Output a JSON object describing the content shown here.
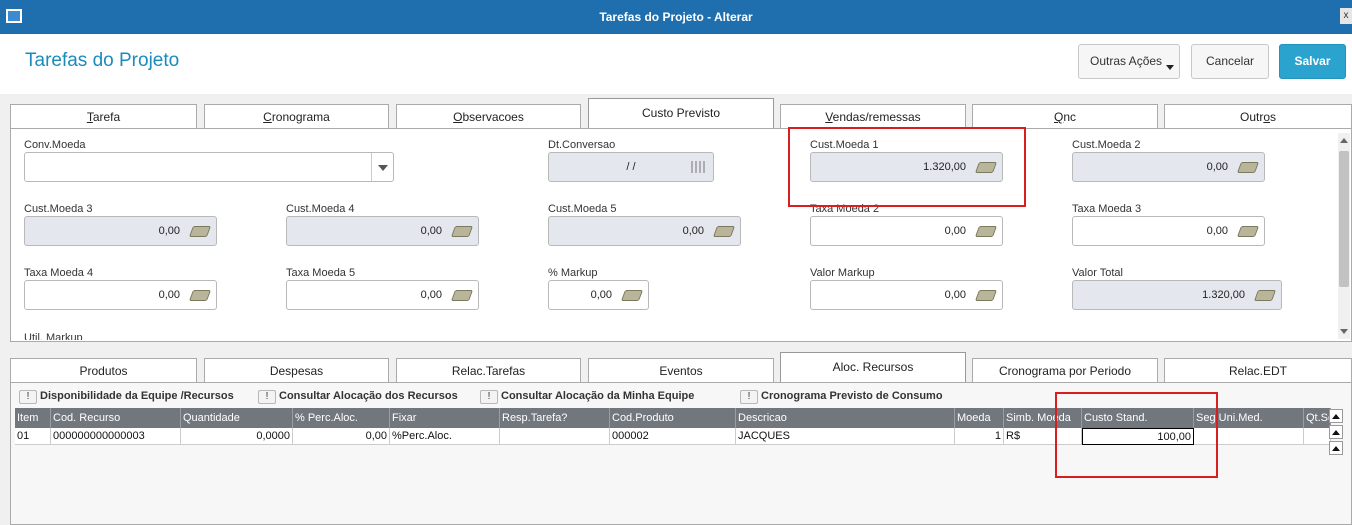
{
  "window": {
    "title": "Tarefas do Projeto - Alterar",
    "close_label": "x"
  },
  "page": {
    "title": "Tarefas do Projeto"
  },
  "actions": {
    "outras": "Outras Ações",
    "cancelar": "Cancelar",
    "salvar": "Salvar"
  },
  "top_tabs": [
    {
      "pre": "",
      "u": "T",
      "post": "arefa"
    },
    {
      "pre": "",
      "u": "C",
      "post": "ronograma"
    },
    {
      "pre": "",
      "u": "O",
      "post": "bservacoes"
    },
    {
      "pre": "Custo Previsto",
      "u": "",
      "post": ""
    },
    {
      "pre": "",
      "u": "V",
      "post": "endas/remessas"
    },
    {
      "pre": "",
      "u": "Q",
      "post": "nc"
    },
    {
      "pre": "Outr",
      "u": "o",
      "post": "s"
    }
  ],
  "form": {
    "conv_moeda": {
      "label": "Conv.Moeda",
      "value": ""
    },
    "dt_conversao": {
      "label": "Dt.Conversao",
      "value": "/ /"
    },
    "cust_moeda_1": {
      "label": "Cust.Moeda 1",
      "value": "1.320,00"
    },
    "cust_moeda_2": {
      "label": "Cust.Moeda 2",
      "value": "0,00"
    },
    "cust_moeda_3": {
      "label": "Cust.Moeda 3",
      "value": "0,00"
    },
    "cust_moeda_4": {
      "label": "Cust.Moeda 4",
      "value": "0,00"
    },
    "cust_moeda_5": {
      "label": "Cust.Moeda 5",
      "value": "0,00"
    },
    "taxa_moeda_2": {
      "label": "Taxa Moeda 2",
      "value": "0,00"
    },
    "taxa_moeda_3": {
      "label": "Taxa Moeda 3",
      "value": "0,00"
    },
    "taxa_moeda_4": {
      "label": "Taxa Moeda 4",
      "value": "0,00"
    },
    "taxa_moeda_5": {
      "label": "Taxa Moeda 5",
      "value": "0,00"
    },
    "markup": {
      "label": "% Markup",
      "value": "0,00"
    },
    "valor_markup": {
      "label": "Valor Markup",
      "value": "0,00"
    },
    "valor_total": {
      "label": "Valor Total",
      "value": "1.320,00"
    },
    "util_markup": {
      "label": "Util. Markup"
    }
  },
  "bottom_tabs": [
    "Produtos",
    "Despesas",
    "Relac.Tarefas",
    "Eventos",
    "Aloc. Recursos",
    "Cronograma por Periodo",
    "Relac.EDT"
  ],
  "grid_actions": [
    "Disponibilidade da Equipe /Recursos",
    "Consultar Alocação dos Recursos",
    "Consultar Alocação da Minha Equipe",
    "Cronograma Previsto de Consumo"
  ],
  "grid": {
    "columns": [
      "Item",
      "Cod. Recurso",
      "Quantidade",
      "% Perc.Aloc.",
      "Fixar",
      "Resp.Tarefa?",
      "Cod.Produto",
      "Descricao",
      "Moeda",
      "Simb. Moeda",
      "Custo Stand.",
      "Seg.Uni.Med.",
      "Qt.Se"
    ],
    "rows": [
      [
        "01",
        "000000000000003",
        "0,0000",
        "0,00",
        "%Perc.Aloc.",
        "",
        "000002",
        "JACQUES",
        "1",
        "R$",
        "100,00",
        "",
        ""
      ]
    ]
  },
  "icons": [
    "coin-stack-icon",
    "calendar-icon",
    "chevron-down-icon",
    "alert-icon",
    "scroll-top-icon",
    "scroll-up-icon"
  ],
  "colors": {
    "titlebar": "#1f6fae",
    "accent": "#1a8bbd",
    "save": "#2aa3cf",
    "highlight": "#d81e1e",
    "grid_header": "#72767d"
  }
}
